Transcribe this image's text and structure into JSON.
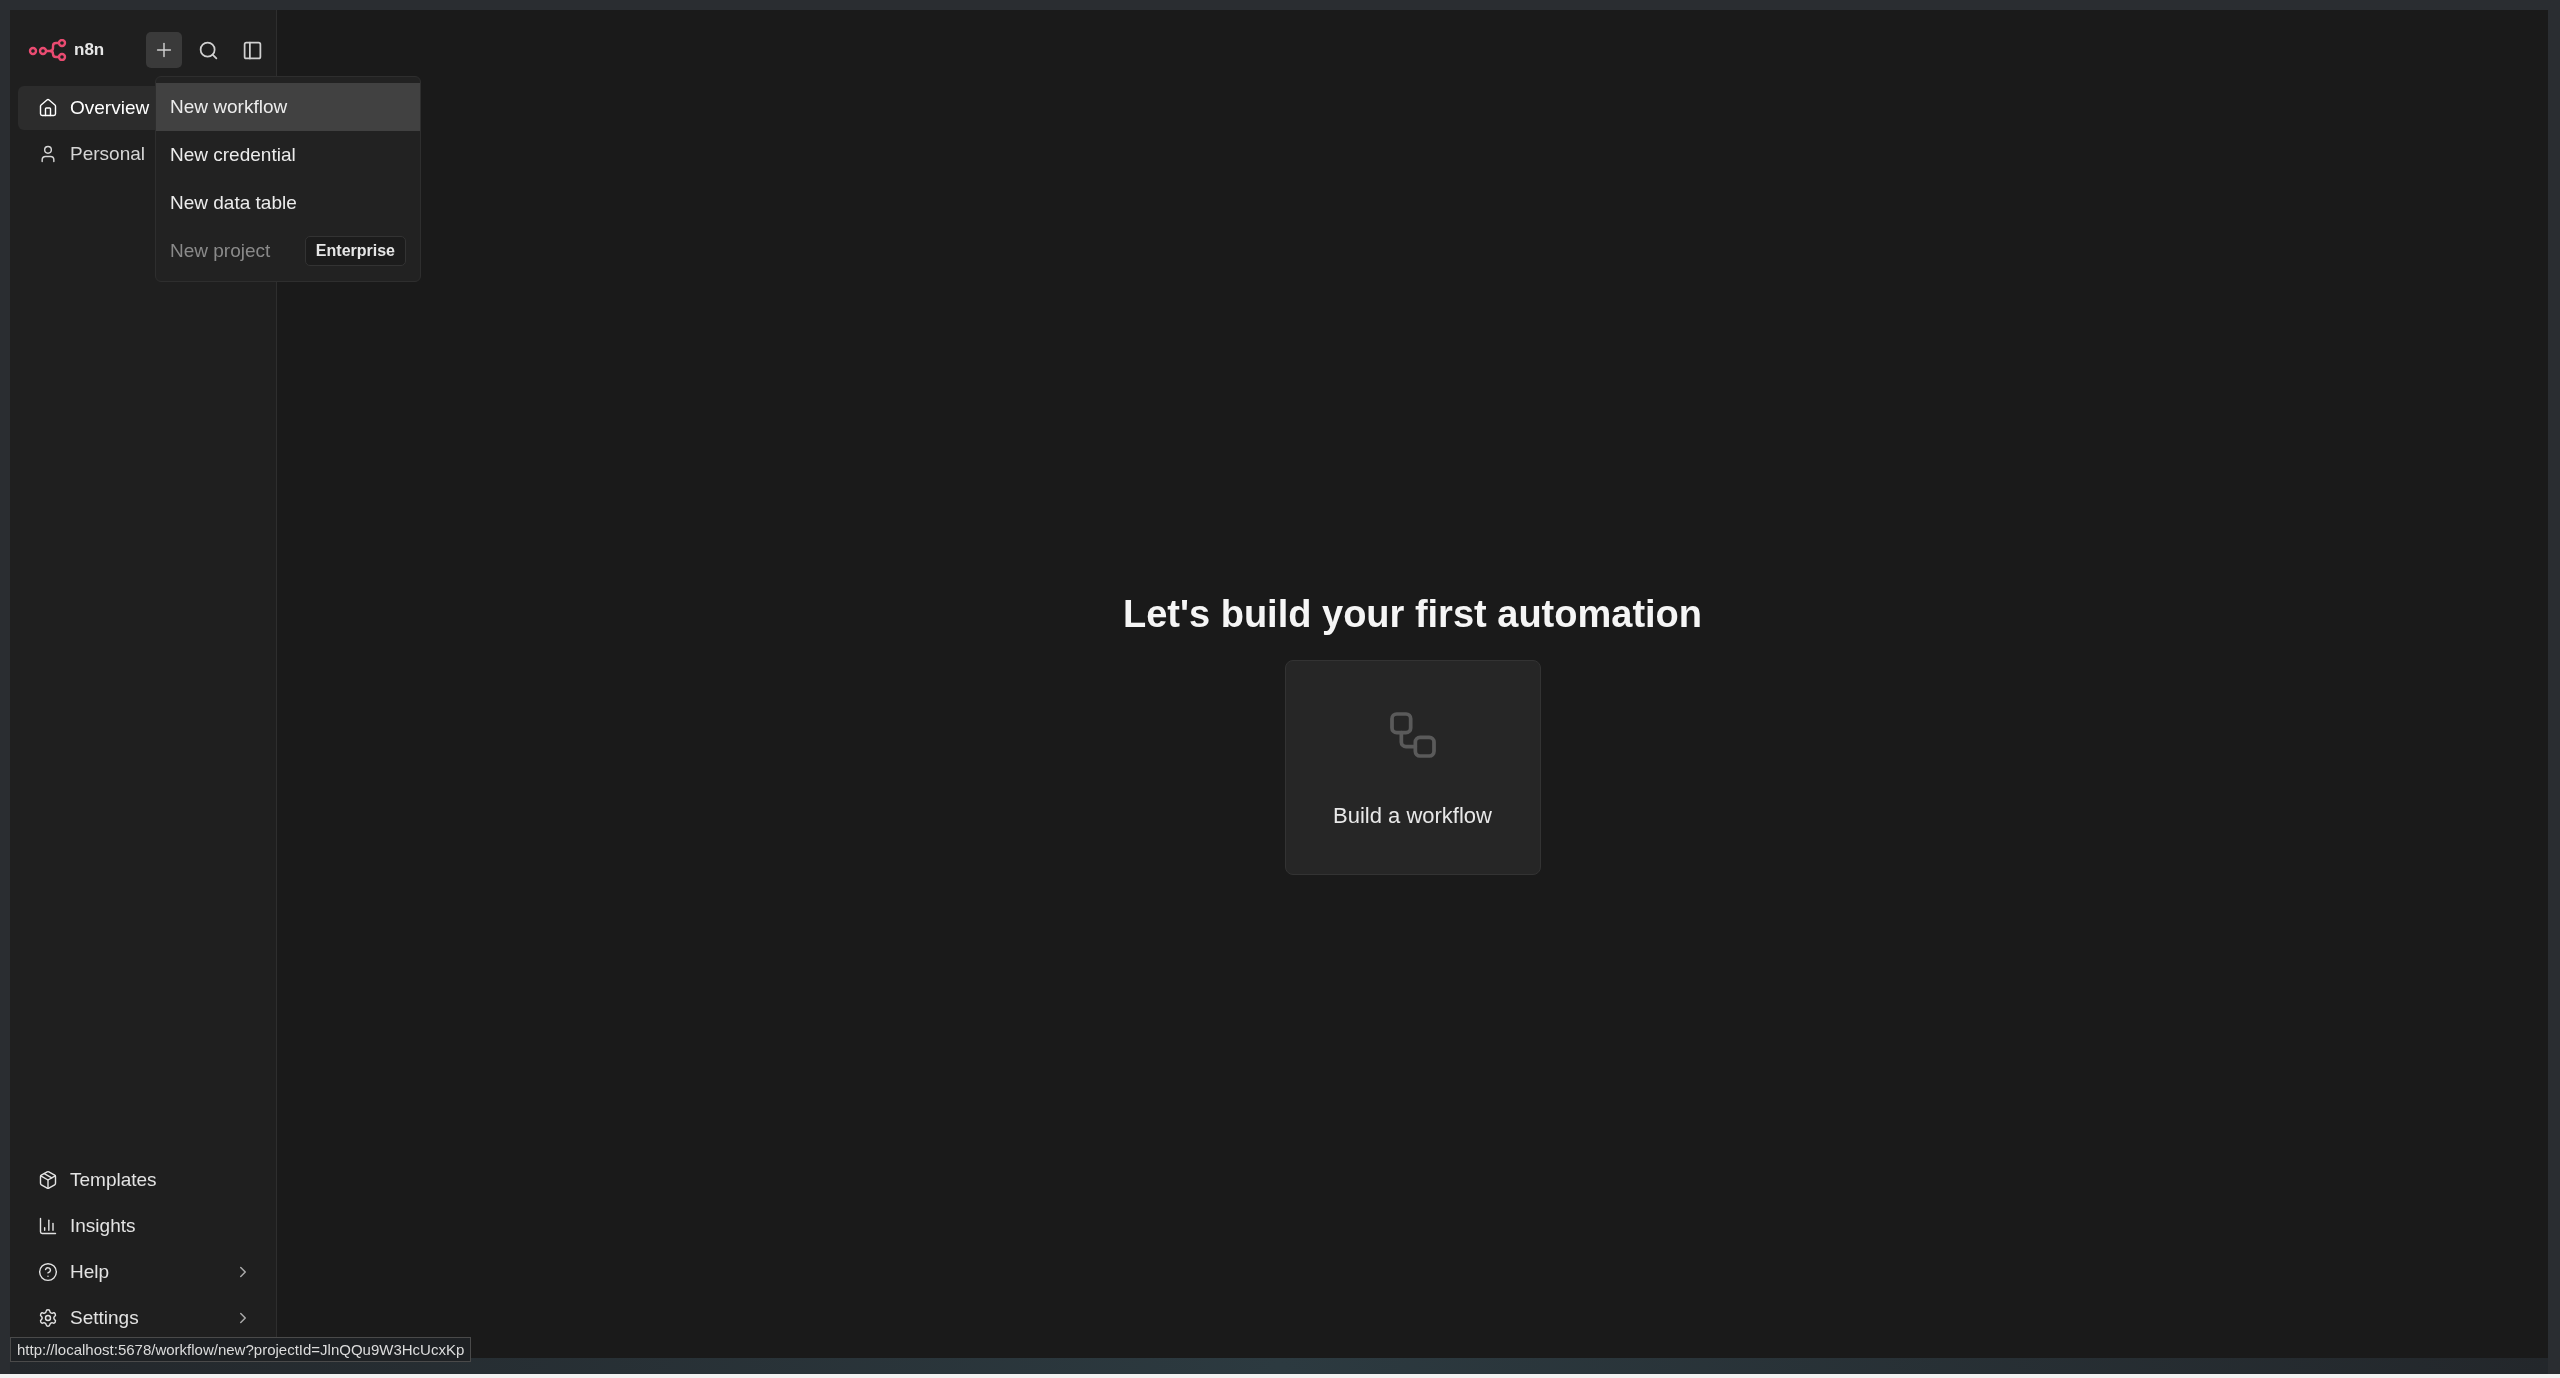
{
  "logo": {
    "text": "n8n"
  },
  "sidebar": {
    "nav": [
      {
        "label": "Overview",
        "selected": true
      },
      {
        "label": "Personal",
        "selected": false
      }
    ],
    "bottom": [
      {
        "label": "Templates",
        "submenu": false
      },
      {
        "label": "Insights",
        "submenu": false
      },
      {
        "label": "Help",
        "submenu": true
      },
      {
        "label": "Settings",
        "submenu": true
      }
    ]
  },
  "create_menu": {
    "items": [
      {
        "label": "New workflow",
        "highlighted": true,
        "disabled": false
      },
      {
        "label": "New credential",
        "highlighted": false,
        "disabled": false
      },
      {
        "label": "New data table",
        "highlighted": false,
        "disabled": false
      },
      {
        "label": "New project",
        "highlighted": false,
        "disabled": true,
        "badge": "Enterprise"
      }
    ]
  },
  "main": {
    "heading": "Let's build your first automation",
    "card": {
      "label": "Build a workflow"
    }
  },
  "status_url": "http://localhost:5678/workflow/new?projectId=JlnQQu9W3HcUcxKp"
}
